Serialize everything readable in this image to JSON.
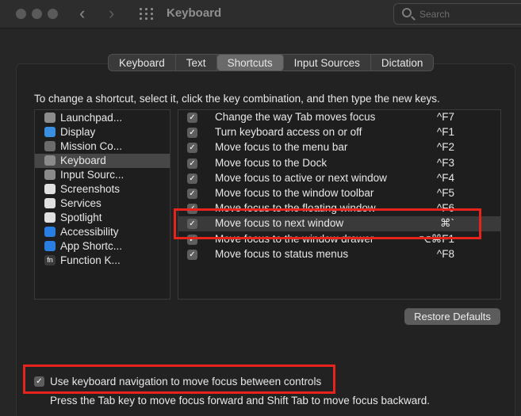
{
  "window": {
    "title": "Keyboard",
    "nav_back": "‹",
    "nav_forward": "›",
    "search_placeholder": "Search"
  },
  "tabs": [
    {
      "label": "Keyboard"
    },
    {
      "label": "Text"
    },
    {
      "label": "Shortcuts",
      "active": true
    },
    {
      "label": "Input Sources"
    },
    {
      "label": "Dictation"
    }
  ],
  "instruction": "To change a shortcut, select it, click the key combination, and then type the new keys.",
  "categories": [
    {
      "label": "Launchpad...",
      "icon": "launchpad-icon",
      "color": "#8c8c8c"
    },
    {
      "label": "Display",
      "icon": "display-icon",
      "color": "#3b8fe0"
    },
    {
      "label": "Mission Co...",
      "icon": "mission-control-icon",
      "color": "#6b6b6b"
    },
    {
      "label": "Keyboard",
      "icon": "keyboard-icon",
      "color": "#8a8a8a",
      "selected": true
    },
    {
      "label": "Input Sourc...",
      "icon": "input-sources-icon",
      "color": "#8a8a8a"
    },
    {
      "label": "Screenshots",
      "icon": "screenshots-icon",
      "color": "#e0e0e0"
    },
    {
      "label": "Services",
      "icon": "services-icon",
      "color": "#e0e0e0"
    },
    {
      "label": "Spotlight",
      "icon": "spotlight-icon",
      "color": "#e0e0e0"
    },
    {
      "label": "Accessibility",
      "icon": "accessibility-icon",
      "color": "#2a7de1"
    },
    {
      "label": "App Shortc...",
      "icon": "app-shortcuts-icon",
      "color": "#2a7de1"
    },
    {
      "label": "Function K...",
      "icon": "function-keys-icon",
      "color": "#3a3a3a",
      "glyph": "fn"
    }
  ],
  "shortcuts": [
    {
      "label": "Change the way Tab moves focus",
      "key": "^F7",
      "checked": true
    },
    {
      "label": "Turn keyboard access on or off",
      "key": "^F1",
      "checked": true
    },
    {
      "label": "Move focus to the menu bar",
      "key": "^F2",
      "checked": true
    },
    {
      "label": "Move focus to the Dock",
      "key": "^F3",
      "checked": true
    },
    {
      "label": "Move focus to active or next window",
      "key": "^F4",
      "checked": true
    },
    {
      "label": "Move focus to the window toolbar",
      "key": "^F5",
      "checked": true
    },
    {
      "label": "Move focus to the floating window",
      "key": "^F6",
      "checked": true
    },
    {
      "label": "Move focus to next window",
      "key": "⌘`",
      "checked": true,
      "highlighted": true
    },
    {
      "label": "Move focus to the window drawer",
      "key": "⌥⌘F1",
      "checked": true
    },
    {
      "label": "Move focus to status menus",
      "key": "^F8",
      "checked": true
    }
  ],
  "restore_button": "Restore Defaults",
  "keyboard_navigation": {
    "label": "Use keyboard navigation to move focus between controls",
    "checked": true,
    "hint": "Press the Tab key to move focus forward and Shift Tab to move focus backward."
  },
  "check_glyph": "✓",
  "colors": {
    "annotation": "#e8231b",
    "background": "#262626"
  }
}
